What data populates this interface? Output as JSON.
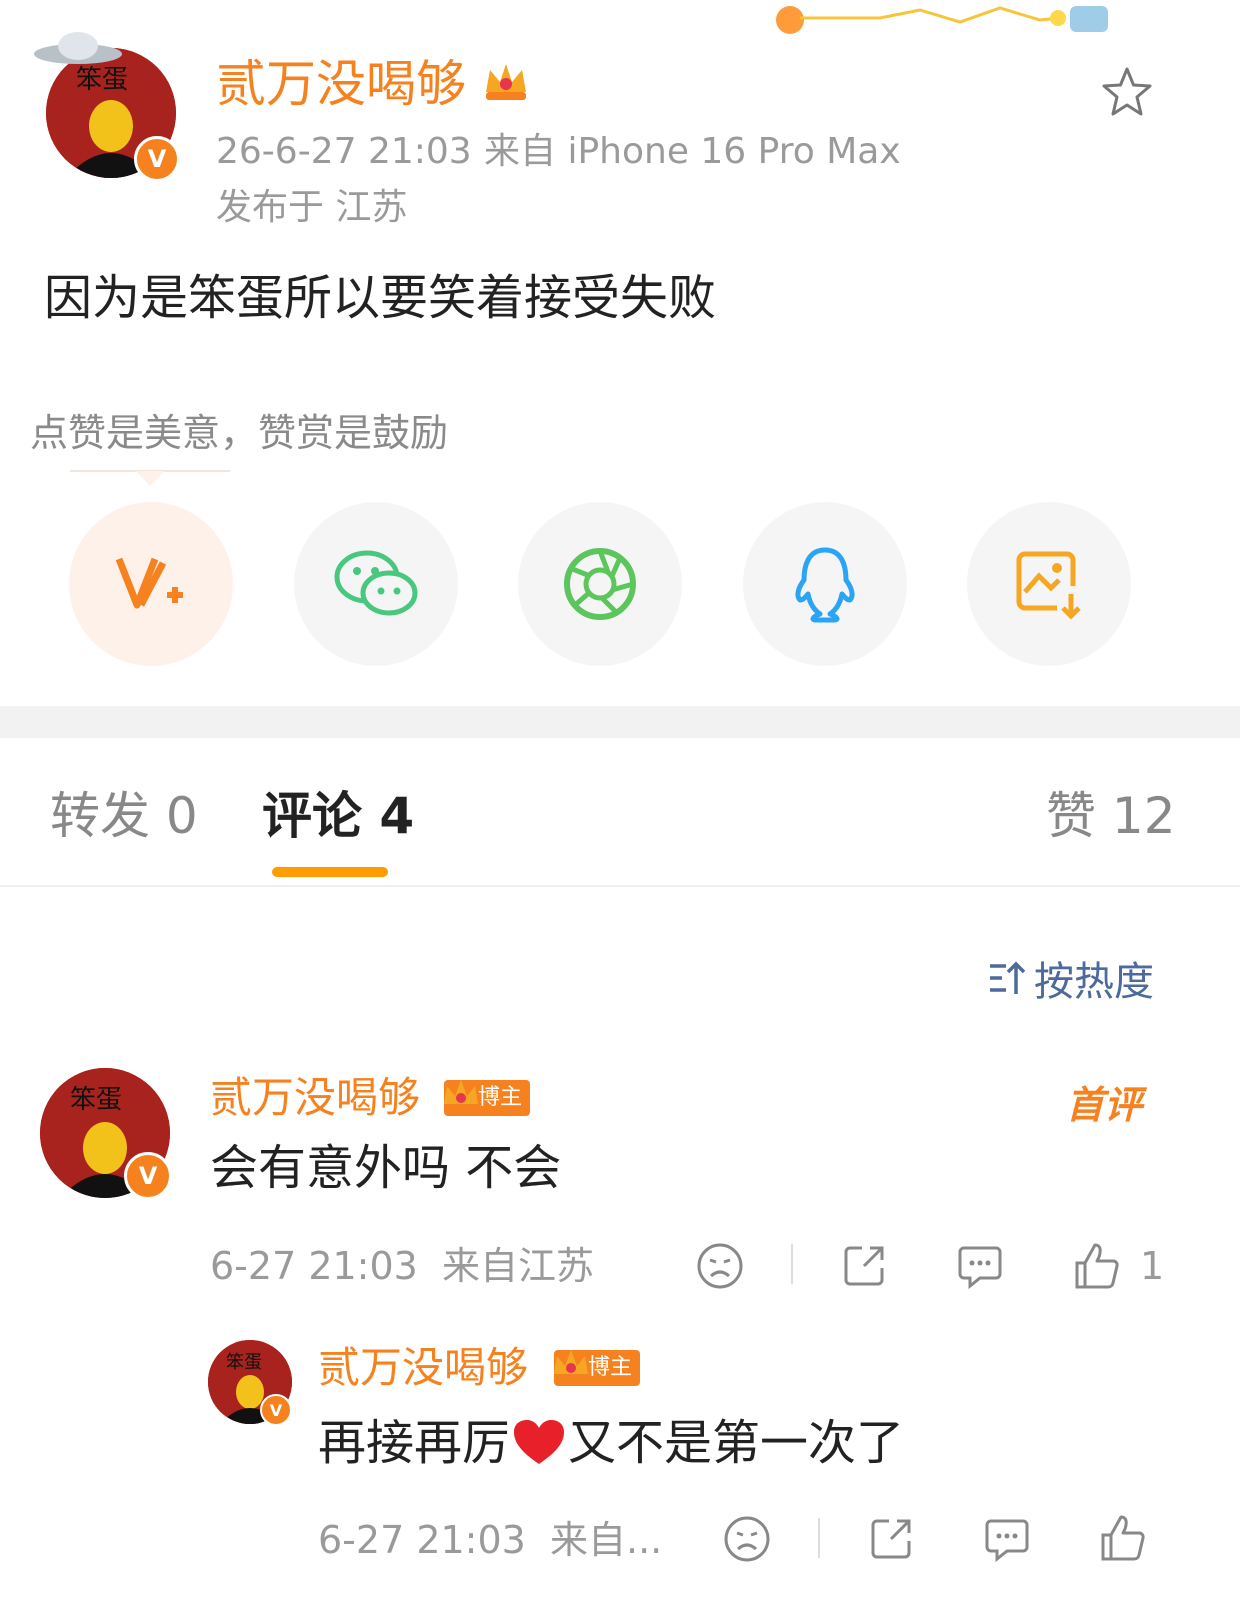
{
  "post": {
    "author": "贰万没喝够",
    "timestamp": "26-6-27 21:03",
    "device": "来自 iPhone 16 Pro Max",
    "location": "发布于 江苏",
    "content": "因为是笨蛋所以要笑着接受失败",
    "avatar_text": "笨蛋"
  },
  "reward": {
    "prompt": "点赞是美意，赞赏是鼓励"
  },
  "share": {
    "items": [
      {
        "name": "weibo-v-plus-icon"
      },
      {
        "name": "wechat-icon"
      },
      {
        "name": "moments-icon"
      },
      {
        "name": "qq-icon"
      },
      {
        "name": "save-image-icon"
      }
    ]
  },
  "tabs": {
    "repost": "转发 0",
    "comments": "评论 4",
    "likes": "赞 12"
  },
  "sort": {
    "label": "按热度"
  },
  "comments": [
    {
      "author": "贰万没喝够",
      "badge": "博主",
      "first_label": "首评",
      "text": "会有意外吗 不会",
      "meta": "6-27 21:03  来自江苏",
      "like_count": "1"
    }
  ],
  "reply": {
    "author": "贰万没喝够",
    "badge": "博主",
    "text_a": "再接再厉",
    "text_b": "又不是第一次了",
    "meta": "6-27 21:03  来自..."
  },
  "colors": {
    "accent": "#f5821f",
    "tab_underline": "#ff9c00",
    "wechat_green": "#48c87f",
    "qq_blue": "#2aa4f4",
    "sort_blue": "#4c6a9c"
  }
}
